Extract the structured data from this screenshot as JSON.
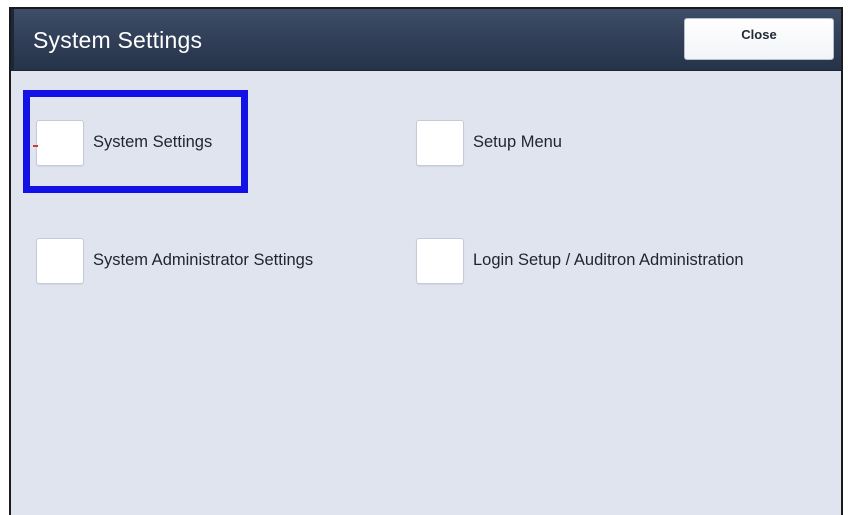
{
  "header": {
    "title": "System Settings",
    "close_label": "Close"
  },
  "options": [
    {
      "label": "System Settings",
      "checked": false,
      "highlighted": true
    },
    {
      "label": "Setup Menu",
      "checked": false,
      "highlighted": false
    },
    {
      "label": "System Administrator Settings",
      "checked": false,
      "highlighted": false
    },
    {
      "label": "Login Setup / Auditron Administration",
      "checked": false,
      "highlighted": false
    }
  ],
  "colors": {
    "titlebar": "#2f3e56",
    "panel_background": "#dfe4ef",
    "highlight_outline": "#1212e6"
  }
}
